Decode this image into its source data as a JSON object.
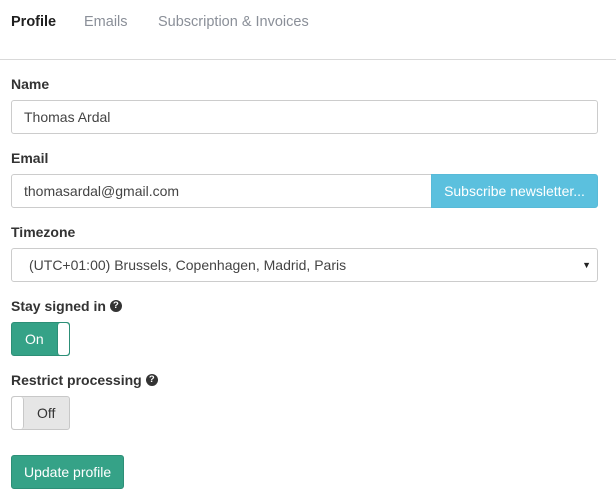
{
  "tabs": [
    {
      "label": "Profile",
      "active": true
    },
    {
      "label": "Emails",
      "active": false
    },
    {
      "label": "Subscription & Invoices",
      "active": false
    }
  ],
  "form": {
    "name_label": "Name",
    "name_value": "Thomas Ardal",
    "email_label": "Email",
    "email_value": "thomasardal@gmail.com",
    "subscribe_label": "Subscribe newsletter...",
    "timezone_label": "Timezone",
    "timezone_value": "(UTC+01:00) Brussels, Copenhagen, Madrid, Paris",
    "stay_signed_in_label": "Stay signed in",
    "stay_signed_in_state": "On",
    "restrict_processing_label": "Restrict processing",
    "restrict_processing_state": "Off",
    "update_button_label": "Update profile"
  },
  "icons": {
    "help": "question-circle-icon",
    "select_caret": "caret-down-icon"
  },
  "colors": {
    "primary": "#35a287",
    "info": "#5bc0de",
    "tab_inactive": "#8a8f98"
  }
}
